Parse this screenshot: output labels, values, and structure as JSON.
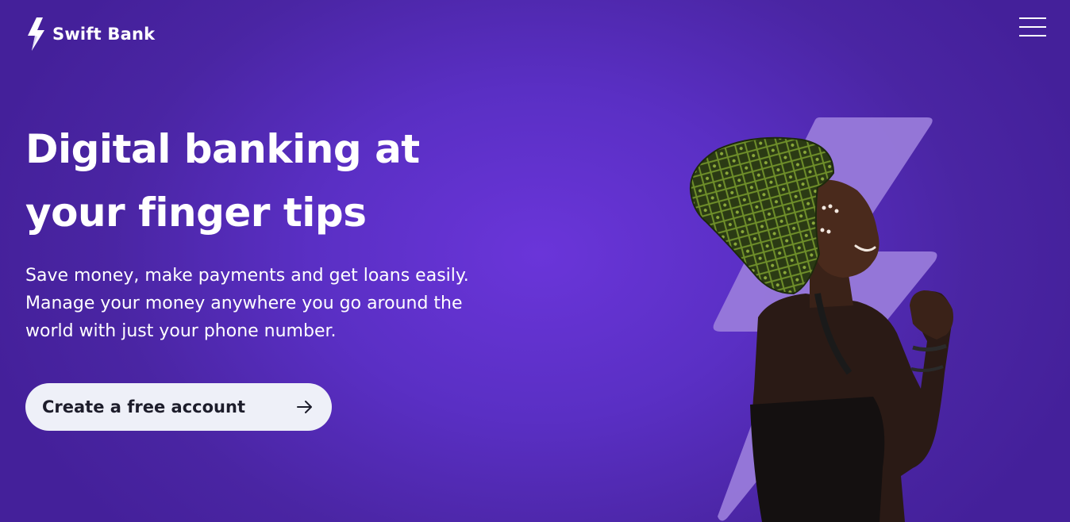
{
  "header": {
    "brand_name": "Swift Bank",
    "logo_icon": "lightning-bolt-icon",
    "menu_icon": "hamburger-menu-icon"
  },
  "hero": {
    "headline_line1": "Digital banking at",
    "headline_line2": "your finger tips",
    "subtext_line1": "Save money, make payments and get loans easily.",
    "subtext_line2": "Manage your money anywhere you go around the",
    "subtext_line3": "world with just your phone number.",
    "cta_label": "Create a free account",
    "cta_icon": "arrow-right-icon"
  },
  "illustration": {
    "bolt_icon": "lightning-bolt-shape",
    "image_subject": "hero-portrait"
  },
  "colors": {
    "background": "#5a2fc4",
    "background_center": "#6a35d9",
    "bolt": "#9a7ddb",
    "button_bg": "#eef0f8",
    "button_text": "#1d1d2b",
    "text": "#ffffff"
  }
}
